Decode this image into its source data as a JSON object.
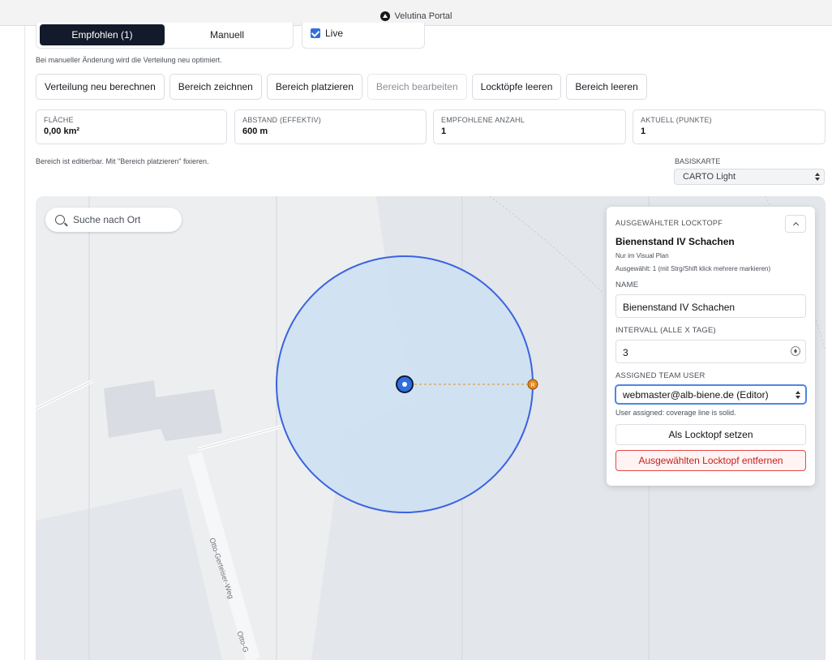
{
  "window": {
    "title": "Velutina Portal"
  },
  "mode_tabs": {
    "recommended": "Empfohlen (1)",
    "manual": "Manuell"
  },
  "live": {
    "label": "Live",
    "checked": true
  },
  "hint_manual": "Bei manueller Änderung wird die Verteilung neu optimiert.",
  "toolbar": [
    {
      "label": "Verteilung neu berechnen",
      "enabled": true
    },
    {
      "label": "Bereich zeichnen",
      "enabled": true
    },
    {
      "label": "Bereich platzieren",
      "enabled": true
    },
    {
      "label": "Bereich bearbeiten",
      "enabled": false
    },
    {
      "label": "Locktöpfe leeren",
      "enabled": true
    },
    {
      "label": "Bereich leeren",
      "enabled": true
    }
  ],
  "stats": [
    {
      "label": "FLÄCHE",
      "value": "0,00 km²"
    },
    {
      "label": "ABSTAND (EFFEKTIV)",
      "value": "600 m"
    },
    {
      "label": "EMPFOHLENE ANZAHL",
      "value": "1"
    },
    {
      "label": "AKTUELL (PUNKTE)",
      "value": "1"
    }
  ],
  "hint_edit": "Bereich ist editierbar. Mit \"Bereich platzieren\" fixieren.",
  "basemap": {
    "label": "BASISKARTE",
    "selected": "CARTO Light"
  },
  "map": {
    "search_placeholder": "Suche nach Ort",
    "streets": [
      "Otto-Gerteiser-Weg",
      "Otto-G"
    ],
    "radius_marker_label": "R",
    "colors": {
      "coverage_fill": "#cddff3",
      "coverage_stroke": "#3a63e0",
      "center": "#2f6fe0",
      "radius_handle": "#e58a1f"
    }
  },
  "panel": {
    "header": "AUSGEWÄHLTER LOCKTOPF",
    "title": "Bienenstand IV Schachen",
    "subtitle": "Nur im Visual Plan",
    "selection_hint": "Ausgewählt: 1 (mit Strg/Shift klick mehrere markieren)",
    "name_label": "NAME",
    "name_value": "Bienenstand IV Schachen",
    "interval_label": "INTERVALL (ALLE X TAGE)",
    "interval_value": "3",
    "assigned_label": "ASSIGNED TEAM USER",
    "assigned_value": "webmaster@alb-biene.de (Editor)",
    "assigned_note": "User assigned: coverage line is solid.",
    "set_button": "Als Locktopf setzen",
    "remove_button": "Ausgewählten Locktopf entfernen"
  }
}
